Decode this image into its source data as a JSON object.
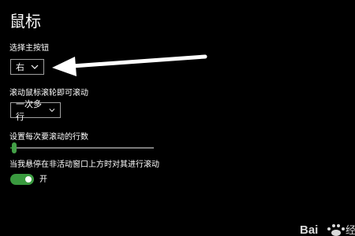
{
  "page": {
    "title": "鼠标"
  },
  "primary_button": {
    "label": "选择主按钮",
    "value": "右"
  },
  "wheel_scroll": {
    "label": "滚动鼠标滚轮即可滚动",
    "value": "一次多行"
  },
  "lines_to_scroll": {
    "label": "设置每次要滚动的行数",
    "level_fraction": 0.03
  },
  "inactive_scroll": {
    "label": "当我悬停在非活动窗口上方时对其进行滚动",
    "state_text": "开",
    "on": true
  },
  "colors": {
    "background": "#000000",
    "accent": "#3a9a3f",
    "annotation_arrow": "#ffffff"
  },
  "icons": {
    "dropdown": "chevron-down-icon",
    "annotation": "arrow-left-icon"
  },
  "watermark": {
    "text": "Bai"
  }
}
